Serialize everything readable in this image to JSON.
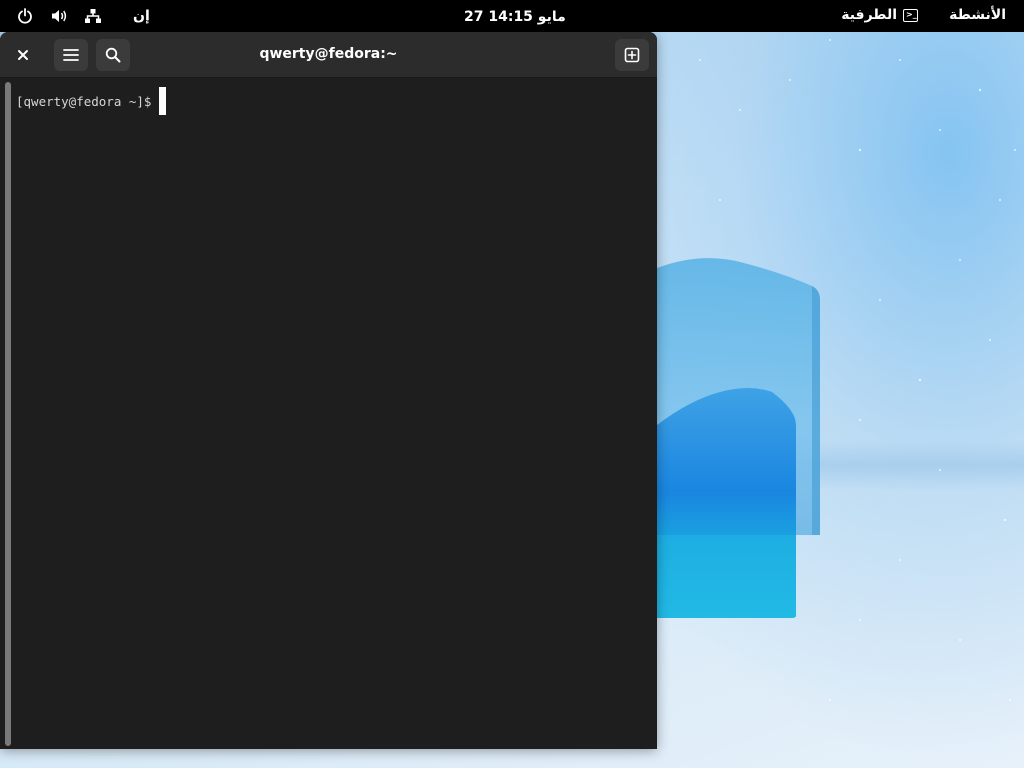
{
  "topbar": {
    "activities_label": "الأنشطة",
    "app_menu_label": "الطرفية",
    "clock": "27 مايو  14:15",
    "input_language": "إن",
    "icons": [
      "power-icon",
      "volume-icon",
      "network-icon",
      "terminal-app-icon"
    ]
  },
  "terminal": {
    "title": "qwerty@fedora:~",
    "prompt": "[qwerty@fedora ~]$",
    "header_icons": [
      "close-icon",
      "menu-icon",
      "search-icon",
      "new-tab-icon"
    ]
  },
  "colors": {
    "topbar_bg": "#000000",
    "terminal_bg": "#1e1e1e",
    "headerbar_bg": "#2c2c2c",
    "wallpaper_accent": "#1aa0e0"
  }
}
